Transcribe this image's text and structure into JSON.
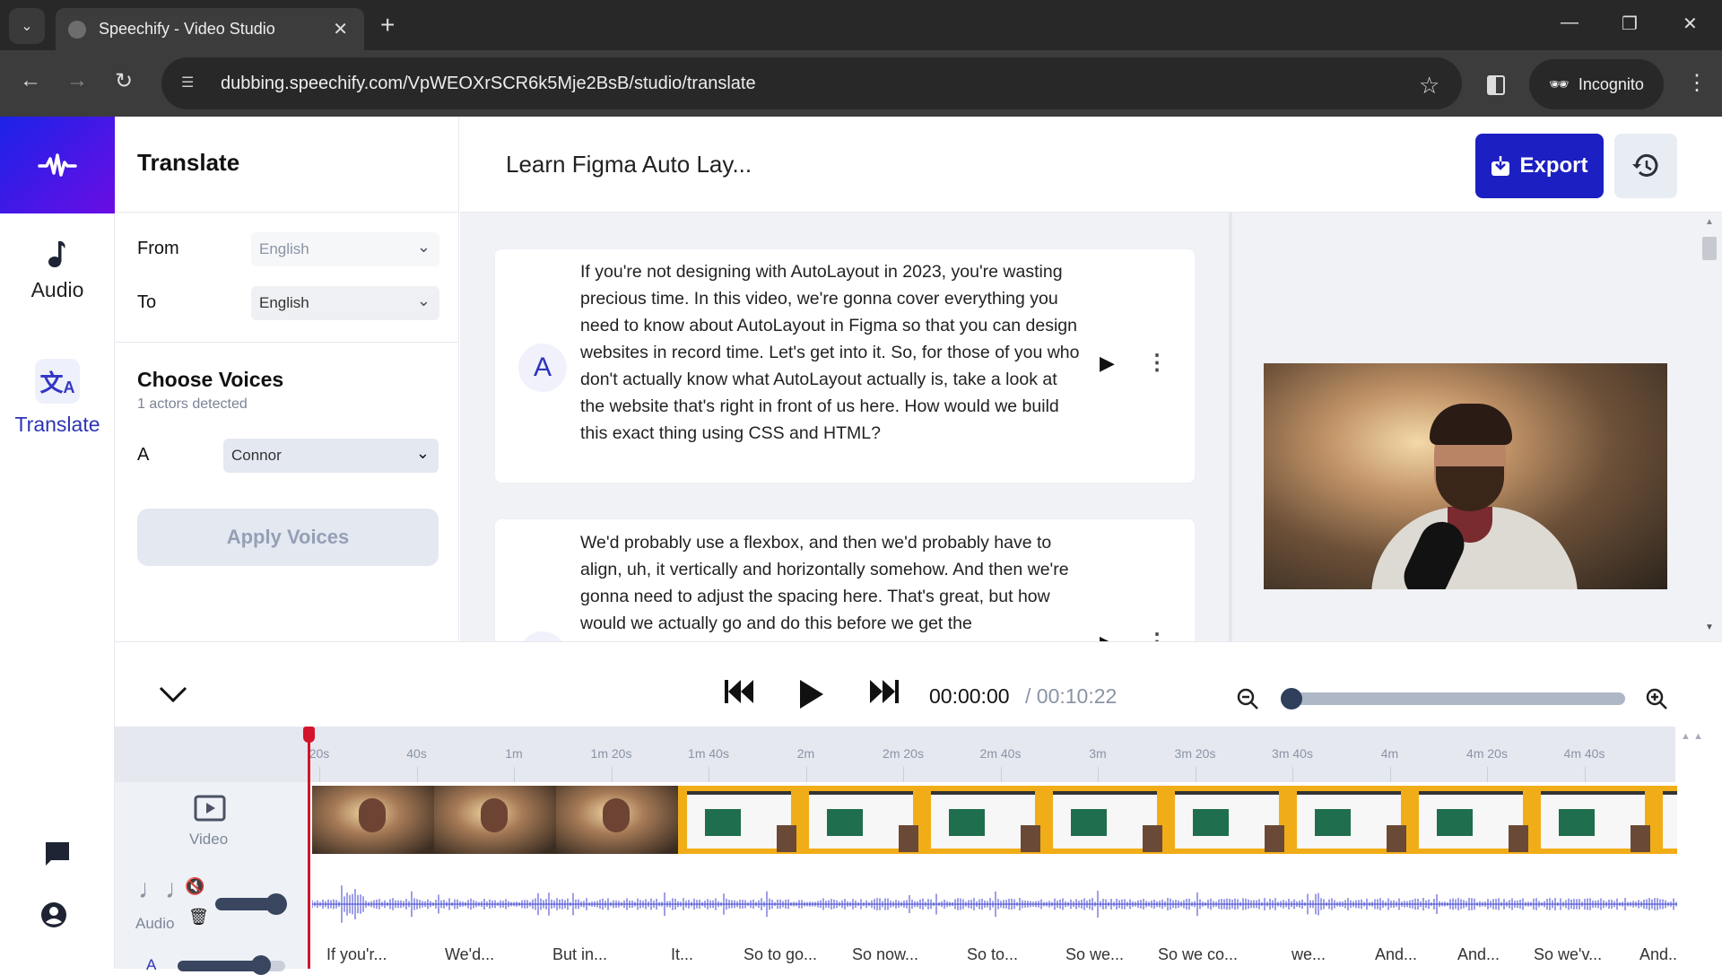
{
  "browser": {
    "tab_title": "Speechify - Video Studio",
    "url": "dubbing.speechify.com/VpWEOXrSCR6k5Mje2BsB/studio/translate",
    "profile_label": "Incognito"
  },
  "rail": {
    "items": [
      {
        "label": "Audio",
        "icon": "music-note-icon",
        "active": false
      },
      {
        "label": "Translate",
        "icon": "translate-icon",
        "active": true
      }
    ]
  },
  "translate_panel": {
    "title": "Translate",
    "from_label": "From",
    "from_value": "English",
    "to_label": "To",
    "to_value": "English",
    "voices_title": "Choose Voices",
    "actors_detected": "1 actors detected",
    "actor_label": "A",
    "actor_voice": "Connor",
    "apply_button": "Apply Voices"
  },
  "header": {
    "project_title": "Learn Figma Auto Lay...",
    "export_label": "Export"
  },
  "transcript": [
    {
      "speaker": "A",
      "text": "If you're not designing with AutoLayout in 2023, you're wasting precious time. In this video, we're gonna cover everything you need to know about AutoLayout in Figma so that you can design websites in record time. Let's get into it. So, for those of you who don't actually know what AutoLayout actually is, take a look at the website that's right in front of us here. How would we build this exact thing using CSS and HTML?"
    },
    {
      "speaker": "A",
      "text": "We'd probably use a flexbox, and then we'd probably have to align, uh, it vertically and horizontally somehow. And then we're gonna need to adjust the spacing here. That's great, but how would we actually go and do this before we get the"
    }
  ],
  "player": {
    "current_time": "00:00:00",
    "separator": " / ",
    "total_time": "00:10:22",
    "zoom_level_fraction": 0.0
  },
  "timeline": {
    "ticks": [
      "20s",
      "40s",
      "1m",
      "1m 20s",
      "1m 40s",
      "2m",
      "2m 20s",
      "2m 40s",
      "3m",
      "3m 20s",
      "3m 40s",
      "4m",
      "4m 20s",
      "4m 40s"
    ],
    "video_label": "Video",
    "audio_label": "Audio",
    "subtitle_track_label": "A",
    "subtitle_words": [
      "If you'r...",
      "We'd...",
      "But in...",
      "It...",
      "So to go...",
      "So now...",
      "So to...",
      "So we...",
      "So we co...",
      "we...",
      "And...",
      "And...",
      "So we'v...",
      "And..."
    ]
  }
}
